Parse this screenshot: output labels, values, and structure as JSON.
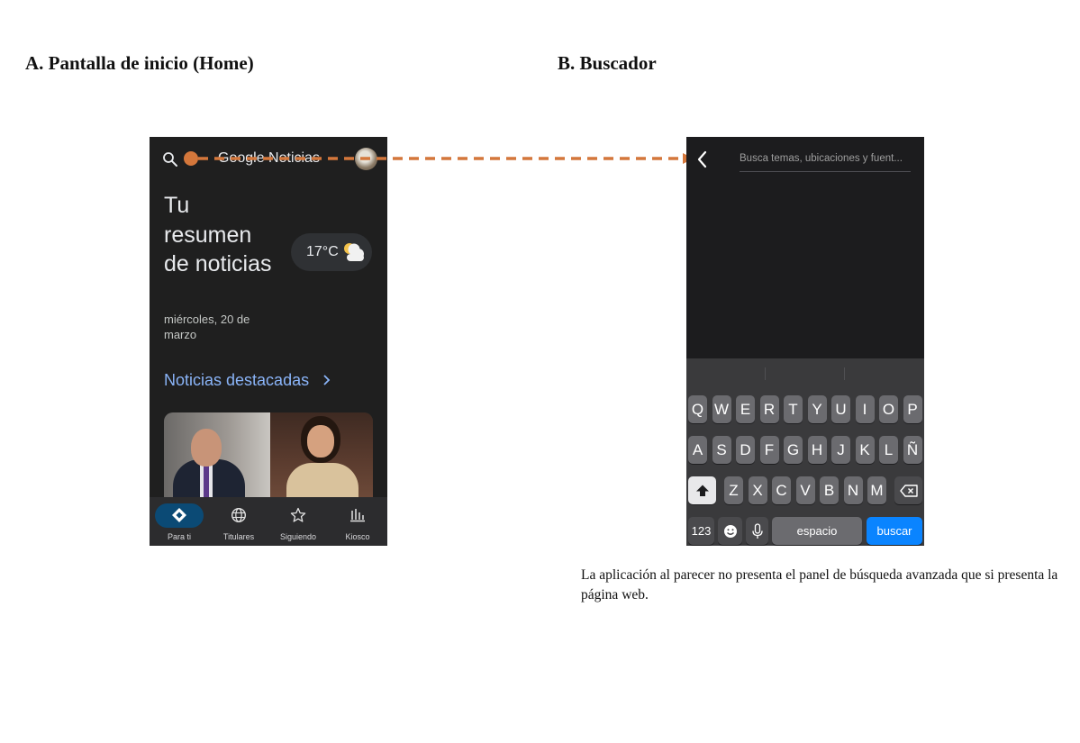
{
  "section_a": {
    "heading": "A. Pantalla de inicio (Home)"
  },
  "section_b": {
    "heading": "B. Buscador"
  },
  "home": {
    "logo": "Google Noticias",
    "title": "Tu resumen de noticias",
    "date": "miércoles, 20 de marzo",
    "temperature": "17°C",
    "weather_icon": "partly-cloudy-icon",
    "featured_label": "Noticias destacadas",
    "nav": [
      {
        "label": "Para ti",
        "icon": "for-you-icon",
        "active": true
      },
      {
        "label": "Titulares",
        "icon": "globe-icon",
        "active": false
      },
      {
        "label": "Siguiendo",
        "icon": "star-icon",
        "active": false
      },
      {
        "label": "Kiosco",
        "icon": "newsstand-icon",
        "active": false
      }
    ]
  },
  "search": {
    "placeholder": "Busca temas, ubicaciones y fuent...",
    "keyboard": {
      "row1": [
        "Q",
        "W",
        "E",
        "R",
        "T",
        "Y",
        "U",
        "I",
        "O",
        "P"
      ],
      "row2": [
        "A",
        "S",
        "D",
        "F",
        "G",
        "H",
        "J",
        "K",
        "L",
        "Ñ"
      ],
      "row3": [
        "Z",
        "X",
        "C",
        "V",
        "B",
        "N",
        "M"
      ],
      "numbers_key": "123",
      "space_key": "espacio",
      "action_key": "buscar"
    }
  },
  "colors": {
    "connector": "#d4773b",
    "accent_blue": "#8ab4f8",
    "key_blue": "#0a84ff"
  },
  "note": "La aplicación al parecer no presenta el panel de búsqueda avanzada que si presenta la página web."
}
